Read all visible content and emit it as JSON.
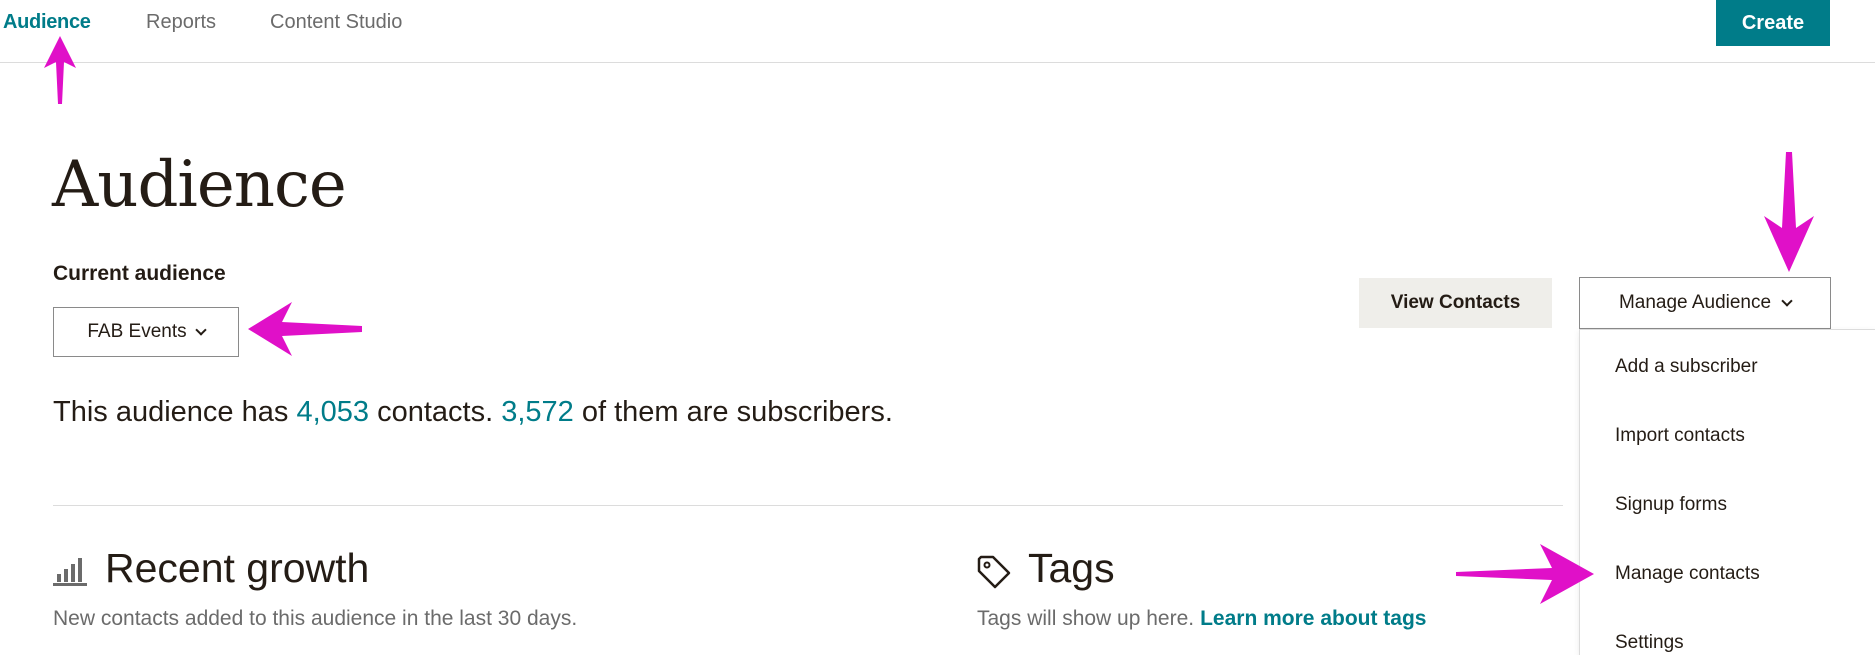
{
  "nav": {
    "items": [
      {
        "label": "Audience",
        "active": true
      },
      {
        "label": "Reports",
        "active": false
      },
      {
        "label": "Content Studio",
        "active": false
      }
    ],
    "create_label": "Create"
  },
  "page": {
    "title": "Audience",
    "current_audience_label": "Current audience",
    "selected_audience": "FAB Events",
    "summary": {
      "prefix": "This audience has ",
      "contacts": "4,053",
      "middle": " contacts. ",
      "subscribers": "3,572",
      "suffix": " of them are subscribers."
    }
  },
  "actions": {
    "view_contacts": "View Contacts",
    "manage_audience": "Manage Audience",
    "menu": [
      "Add a subscriber",
      "Import contacts",
      "Signup forms",
      "Manage contacts",
      "Settings"
    ]
  },
  "sections": {
    "growth": {
      "title": "Recent growth",
      "description": "New contacts added to this audience in the last 30 days.",
      "icon": "bar-chart-icon"
    },
    "tags": {
      "title": "Tags",
      "description": "Tags will show up here.",
      "link": "Learn more about tags",
      "icon": "tag-icon"
    }
  },
  "colors": {
    "accent": "#007c89",
    "annotation_arrow": "#e010c8",
    "text": "#241c15",
    "muted": "#6b6b6b"
  }
}
